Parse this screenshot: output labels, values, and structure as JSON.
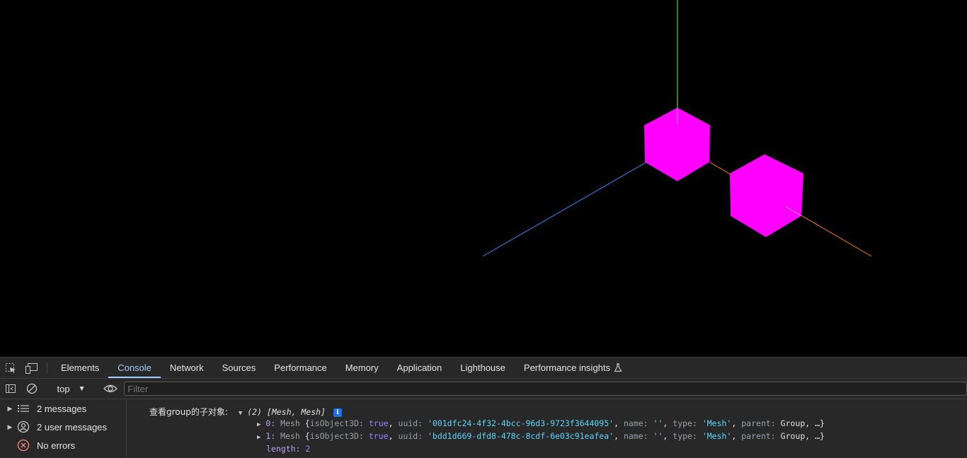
{
  "scene": {
    "background": "#000000",
    "cube_color": "#ff00ff",
    "axis_x_color": "#ff7f00",
    "axis_y_color": "#7fff00",
    "axis_z_color": "#2f8fff"
  },
  "devtools": {
    "tabs": [
      {
        "label": "Elements",
        "active": false
      },
      {
        "label": "Console",
        "active": true
      },
      {
        "label": "Network",
        "active": false
      },
      {
        "label": "Sources",
        "active": false
      },
      {
        "label": "Performance",
        "active": false
      },
      {
        "label": "Memory",
        "active": false
      },
      {
        "label": "Application",
        "active": false
      },
      {
        "label": "Lighthouse",
        "active": false
      },
      {
        "label": "Performance insights",
        "active": false
      }
    ],
    "toolbar": {
      "context": "top",
      "filter_placeholder": "Filter"
    },
    "sidebar": {
      "items": [
        {
          "label": "2 messages",
          "icon": "list-icon"
        },
        {
          "label": "2 user messages",
          "icon": "user-icon"
        },
        {
          "label": "No errors",
          "icon": "error-icon"
        }
      ]
    },
    "console": {
      "log_label": "查看group的子对象:",
      "array_summary": "(2) [Mesh, Mesh]",
      "info_badge": "i",
      "entries": [
        {
          "index": "0:",
          "type": "Mesh",
          "open": "{",
          "p1": "isObject3D:",
          "v1": "true",
          "p2": "uuid:",
          "v2": "'001dfc24-4f32-4bcc-96d3-9723f3644095'",
          "p3": "name:",
          "v3": "''",
          "p4": "type:",
          "v4": "'Mesh'",
          "p5": "parent:",
          "v5": "Group, …}"
        },
        {
          "index": "1:",
          "type": "Mesh",
          "open": "{",
          "p1": "isObject3D:",
          "v1": "true",
          "p2": "uuid:",
          "v2": "'bdd1d669-dfd8-478c-8cdf-6e03c91eafea'",
          "p3": "name:",
          "v3": "''",
          "p4": "type:",
          "v4": "'Mesh'",
          "p5": "parent:",
          "v5": "Group, …}"
        }
      ],
      "length_key": "length:",
      "length_value": "2"
    }
  }
}
